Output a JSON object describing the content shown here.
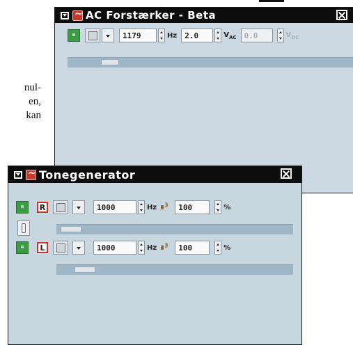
{
  "document": {
    "lines": [
      "nul-",
      "en,",
      "kan"
    ]
  },
  "window_ac": {
    "title": "AC Forstærker - Beta",
    "frequency_value": "1179",
    "frequency_unit": "Hz",
    "voltage_value": "2.0",
    "voltage_unit": "V",
    "voltage_unit_sub": "AC",
    "offset_value": "0.0",
    "offset_unit": "V",
    "offset_unit_sub": "DC"
  },
  "window_tone": {
    "title": "Tonegenerator",
    "channels": [
      {
        "label": "R",
        "frequency_value": "1000",
        "frequency_unit": "Hz",
        "volume_value": "100",
        "volume_unit": "%"
      },
      {
        "label": "L",
        "frequency_value": "1000",
        "frequency_unit": "Hz",
        "volume_value": "100",
        "volume_unit": "%"
      }
    ]
  },
  "colors": {
    "titlebar": "#0d0d0d",
    "window_bg": "#ccd8e2",
    "run_button": "#3d9a47",
    "channel_border": "#c8392b"
  },
  "icons": {
    "menu": "window-menu-icon",
    "app": "oscilloscope-app-icon",
    "close": "close-icon",
    "run": "play-icon",
    "waveform": "waveform-icon",
    "dropdown": "chevron-down-icon",
    "spinner": "spinner-icon",
    "speaker": "speaker-icon",
    "link": "link-channels-icon"
  }
}
